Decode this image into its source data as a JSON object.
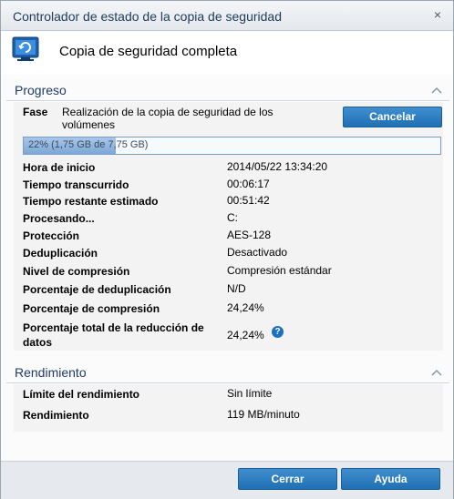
{
  "window": {
    "title": "Controlador de estado de la copia de seguridad",
    "close_glyph": "×"
  },
  "header": {
    "icon": "backup-monitor-icon",
    "title": "Copia de seguridad completa"
  },
  "progress_section": {
    "title": "Progreso",
    "phase_label": "Fase",
    "phase_value": "Realización de la copia de seguridad de los volúmenes",
    "cancel_label": "Cancelar",
    "progress_percent": 22,
    "progress_text": "22% (1,75 GB de 7,75 GB)",
    "rows": [
      {
        "label": "Hora de inicio",
        "value": "2014/05/22 13:34:20"
      },
      {
        "label": "Tiempo transcurrido",
        "value": "00:06:17"
      },
      {
        "label": "Tiempo restante estimado",
        "value": "00:51:42"
      },
      {
        "label": "Procesando...",
        "value": "C:"
      },
      {
        "label": "Protección",
        "value": "AES-128"
      },
      {
        "label": "Deduplicación",
        "value": "Desactivado"
      },
      {
        "label": "Nivel de compresión",
        "value": "Compresión estándar"
      },
      {
        "label": "Porcentaje de deduplicación",
        "value": "N/D"
      },
      {
        "label": "Porcentaje de compresión",
        "value": "24,24%"
      },
      {
        "label": "Porcentaje total de la reducción de datos",
        "value": "24,24%"
      }
    ],
    "help_glyph": "?"
  },
  "performance_section": {
    "title": "Rendimiento",
    "rows": [
      {
        "label": "Límite del rendimiento",
        "value": "Sin límite"
      },
      {
        "label": "Rendimiento",
        "value": "119 MB/minuto"
      }
    ]
  },
  "footer": {
    "close_label": "Cerrar",
    "help_label": "Ayuda"
  },
  "colors": {
    "accent": "#2a7fc4",
    "section_title": "#1f3a6a"
  }
}
